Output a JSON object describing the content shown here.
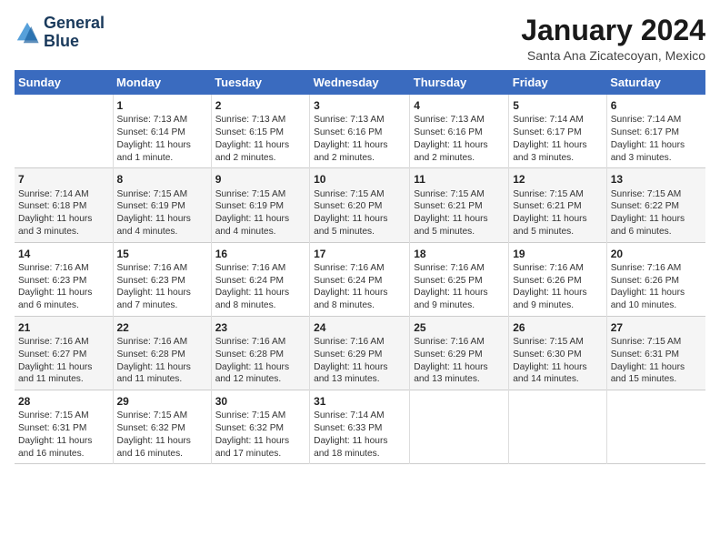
{
  "header": {
    "logo_line1": "General",
    "logo_line2": "Blue",
    "month": "January 2024",
    "location": "Santa Ana Zicatecoyan, Mexico"
  },
  "weekdays": [
    "Sunday",
    "Monday",
    "Tuesday",
    "Wednesday",
    "Thursday",
    "Friday",
    "Saturday"
  ],
  "weeks": [
    [
      {
        "day": "",
        "info": ""
      },
      {
        "day": "1",
        "info": "Sunrise: 7:13 AM\nSunset: 6:14 PM\nDaylight: 11 hours\nand 1 minute."
      },
      {
        "day": "2",
        "info": "Sunrise: 7:13 AM\nSunset: 6:15 PM\nDaylight: 11 hours\nand 2 minutes."
      },
      {
        "day": "3",
        "info": "Sunrise: 7:13 AM\nSunset: 6:16 PM\nDaylight: 11 hours\nand 2 minutes."
      },
      {
        "day": "4",
        "info": "Sunrise: 7:13 AM\nSunset: 6:16 PM\nDaylight: 11 hours\nand 2 minutes."
      },
      {
        "day": "5",
        "info": "Sunrise: 7:14 AM\nSunset: 6:17 PM\nDaylight: 11 hours\nand 3 minutes."
      },
      {
        "day": "6",
        "info": "Sunrise: 7:14 AM\nSunset: 6:17 PM\nDaylight: 11 hours\nand 3 minutes."
      }
    ],
    [
      {
        "day": "7",
        "info": "Sunrise: 7:14 AM\nSunset: 6:18 PM\nDaylight: 11 hours\nand 3 minutes."
      },
      {
        "day": "8",
        "info": "Sunrise: 7:15 AM\nSunset: 6:19 PM\nDaylight: 11 hours\nand 4 minutes."
      },
      {
        "day": "9",
        "info": "Sunrise: 7:15 AM\nSunset: 6:19 PM\nDaylight: 11 hours\nand 4 minutes."
      },
      {
        "day": "10",
        "info": "Sunrise: 7:15 AM\nSunset: 6:20 PM\nDaylight: 11 hours\nand 5 minutes."
      },
      {
        "day": "11",
        "info": "Sunrise: 7:15 AM\nSunset: 6:21 PM\nDaylight: 11 hours\nand 5 minutes."
      },
      {
        "day": "12",
        "info": "Sunrise: 7:15 AM\nSunset: 6:21 PM\nDaylight: 11 hours\nand 5 minutes."
      },
      {
        "day": "13",
        "info": "Sunrise: 7:15 AM\nSunset: 6:22 PM\nDaylight: 11 hours\nand 6 minutes."
      }
    ],
    [
      {
        "day": "14",
        "info": "Sunrise: 7:16 AM\nSunset: 6:23 PM\nDaylight: 11 hours\nand 6 minutes."
      },
      {
        "day": "15",
        "info": "Sunrise: 7:16 AM\nSunset: 6:23 PM\nDaylight: 11 hours\nand 7 minutes."
      },
      {
        "day": "16",
        "info": "Sunrise: 7:16 AM\nSunset: 6:24 PM\nDaylight: 11 hours\nand 8 minutes."
      },
      {
        "day": "17",
        "info": "Sunrise: 7:16 AM\nSunset: 6:24 PM\nDaylight: 11 hours\nand 8 minutes."
      },
      {
        "day": "18",
        "info": "Sunrise: 7:16 AM\nSunset: 6:25 PM\nDaylight: 11 hours\nand 9 minutes."
      },
      {
        "day": "19",
        "info": "Sunrise: 7:16 AM\nSunset: 6:26 PM\nDaylight: 11 hours\nand 9 minutes."
      },
      {
        "day": "20",
        "info": "Sunrise: 7:16 AM\nSunset: 6:26 PM\nDaylight: 11 hours\nand 10 minutes."
      }
    ],
    [
      {
        "day": "21",
        "info": "Sunrise: 7:16 AM\nSunset: 6:27 PM\nDaylight: 11 hours\nand 11 minutes."
      },
      {
        "day": "22",
        "info": "Sunrise: 7:16 AM\nSunset: 6:28 PM\nDaylight: 11 hours\nand 11 minutes."
      },
      {
        "day": "23",
        "info": "Sunrise: 7:16 AM\nSunset: 6:28 PM\nDaylight: 11 hours\nand 12 minutes."
      },
      {
        "day": "24",
        "info": "Sunrise: 7:16 AM\nSunset: 6:29 PM\nDaylight: 11 hours\nand 13 minutes."
      },
      {
        "day": "25",
        "info": "Sunrise: 7:16 AM\nSunset: 6:29 PM\nDaylight: 11 hours\nand 13 minutes."
      },
      {
        "day": "26",
        "info": "Sunrise: 7:15 AM\nSunset: 6:30 PM\nDaylight: 11 hours\nand 14 minutes."
      },
      {
        "day": "27",
        "info": "Sunrise: 7:15 AM\nSunset: 6:31 PM\nDaylight: 11 hours\nand 15 minutes."
      }
    ],
    [
      {
        "day": "28",
        "info": "Sunrise: 7:15 AM\nSunset: 6:31 PM\nDaylight: 11 hours\nand 16 minutes."
      },
      {
        "day": "29",
        "info": "Sunrise: 7:15 AM\nSunset: 6:32 PM\nDaylight: 11 hours\nand 16 minutes."
      },
      {
        "day": "30",
        "info": "Sunrise: 7:15 AM\nSunset: 6:32 PM\nDaylight: 11 hours\nand 17 minutes."
      },
      {
        "day": "31",
        "info": "Sunrise: 7:14 AM\nSunset: 6:33 PM\nDaylight: 11 hours\nand 18 minutes."
      },
      {
        "day": "",
        "info": ""
      },
      {
        "day": "",
        "info": ""
      },
      {
        "day": "",
        "info": ""
      }
    ]
  ]
}
